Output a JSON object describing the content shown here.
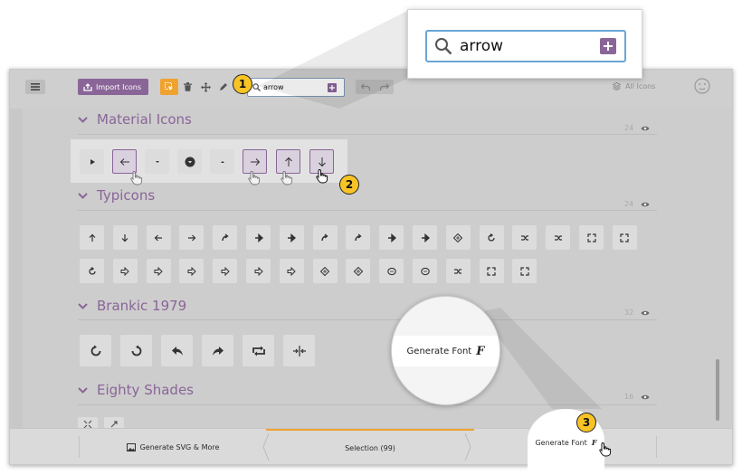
{
  "zoom_callout": {
    "search_value": "arrow"
  },
  "toolbar": {
    "import_label": "Import Icons",
    "search_value": "arrow",
    "all_icons_label": "All Icons"
  },
  "sections": {
    "material": {
      "title": "Material Icons",
      "count": "24"
    },
    "typicons": {
      "title": "Typicons",
      "count": "24"
    },
    "brankic": {
      "title": "Brankic 1979",
      "count": "32"
    },
    "eighty": {
      "title": "Eighty Shades",
      "count": "16"
    }
  },
  "footer": {
    "generate_svg_label": "Generate SVG & More",
    "selection_label": "Selection (99)",
    "generate_font_label": "Generate Font"
  },
  "font_callout": {
    "label": "Generate Font"
  },
  "steps": {
    "one": "1",
    "two": "2",
    "three": "3"
  },
  "colors": {
    "accent": "#8a6598",
    "highlight": "#f0a22e",
    "badge": "#f8c325",
    "focus_border": "#6aa6d6"
  },
  "icons": {
    "material": [
      "play-arrow",
      "arrow-back",
      "arrow-drop-down",
      "arrow-drop-down-circle",
      "arrow-drop-up",
      "arrow-forward",
      "arrow-upward",
      "arrow-downward"
    ],
    "material_selected": [
      "arrow-back",
      "arrow-forward",
      "arrow-upward",
      "arrow-downward"
    ],
    "typicons_row1": [
      "arrow-up",
      "arrow-down",
      "arrow-left",
      "arrow-right",
      "arrow-up-right",
      "arrow-right-thick",
      "arrow-left-thick",
      "arrow-forward",
      "arrow-back",
      "arrow-up-thick",
      "arrow-down-thick",
      "arrow-move",
      "arrow-loop",
      "arrow-shuffle",
      "arrow-repeat",
      "arrow-minimise",
      "arrow-maximise"
    ],
    "typicons_row2": [
      "arrow-sync",
      "arrow-right-outline",
      "arrow-left-outline",
      "arrow-up-outline",
      "arrow-forward-outline",
      "arrow-down-outline",
      "arrow-back-outline",
      "arrow-move-outline",
      "arrow-location-outline",
      "arrow-sync-outline",
      "arrow-loop-outline",
      "arrow-repeat-outline",
      "arrow-minimise-outline",
      "arrow-maximise-outline"
    ],
    "brankic": [
      "refresh-ccw",
      "refresh-cw",
      "reply",
      "forward",
      "loop",
      "split"
    ],
    "eighty": [
      "shrink",
      "expand"
    ]
  }
}
